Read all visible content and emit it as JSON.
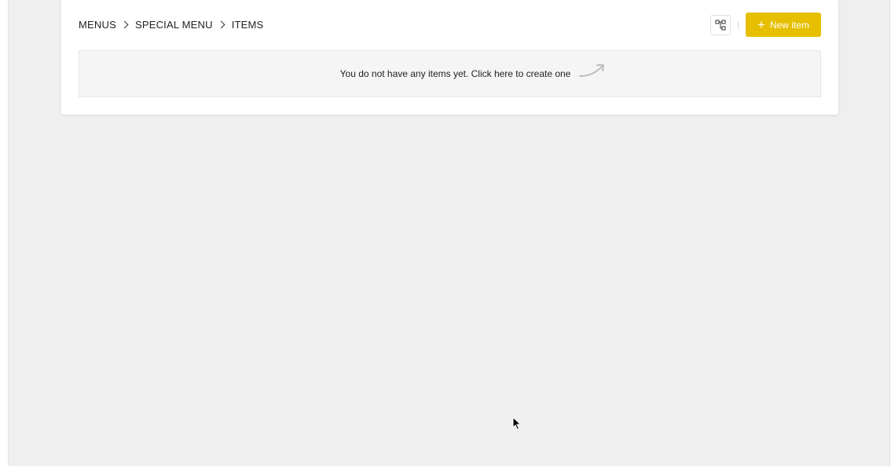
{
  "breadcrumb": {
    "items": [
      "MENUS",
      "SPECIAL MENU",
      "ITEMS"
    ]
  },
  "actions": {
    "tree_icon": "tree-structure-icon",
    "new_item_icon": "plus-icon",
    "new_item_label": "New item"
  },
  "empty_state": {
    "message": "You do not have any items yet. Click here to create one",
    "arrow_icon": "curved-arrow-icon"
  },
  "colors": {
    "accent": "#e6bf00",
    "page_background": "#efefef",
    "card_background": "#ffffff",
    "empty_background": "#f5f5f5"
  }
}
